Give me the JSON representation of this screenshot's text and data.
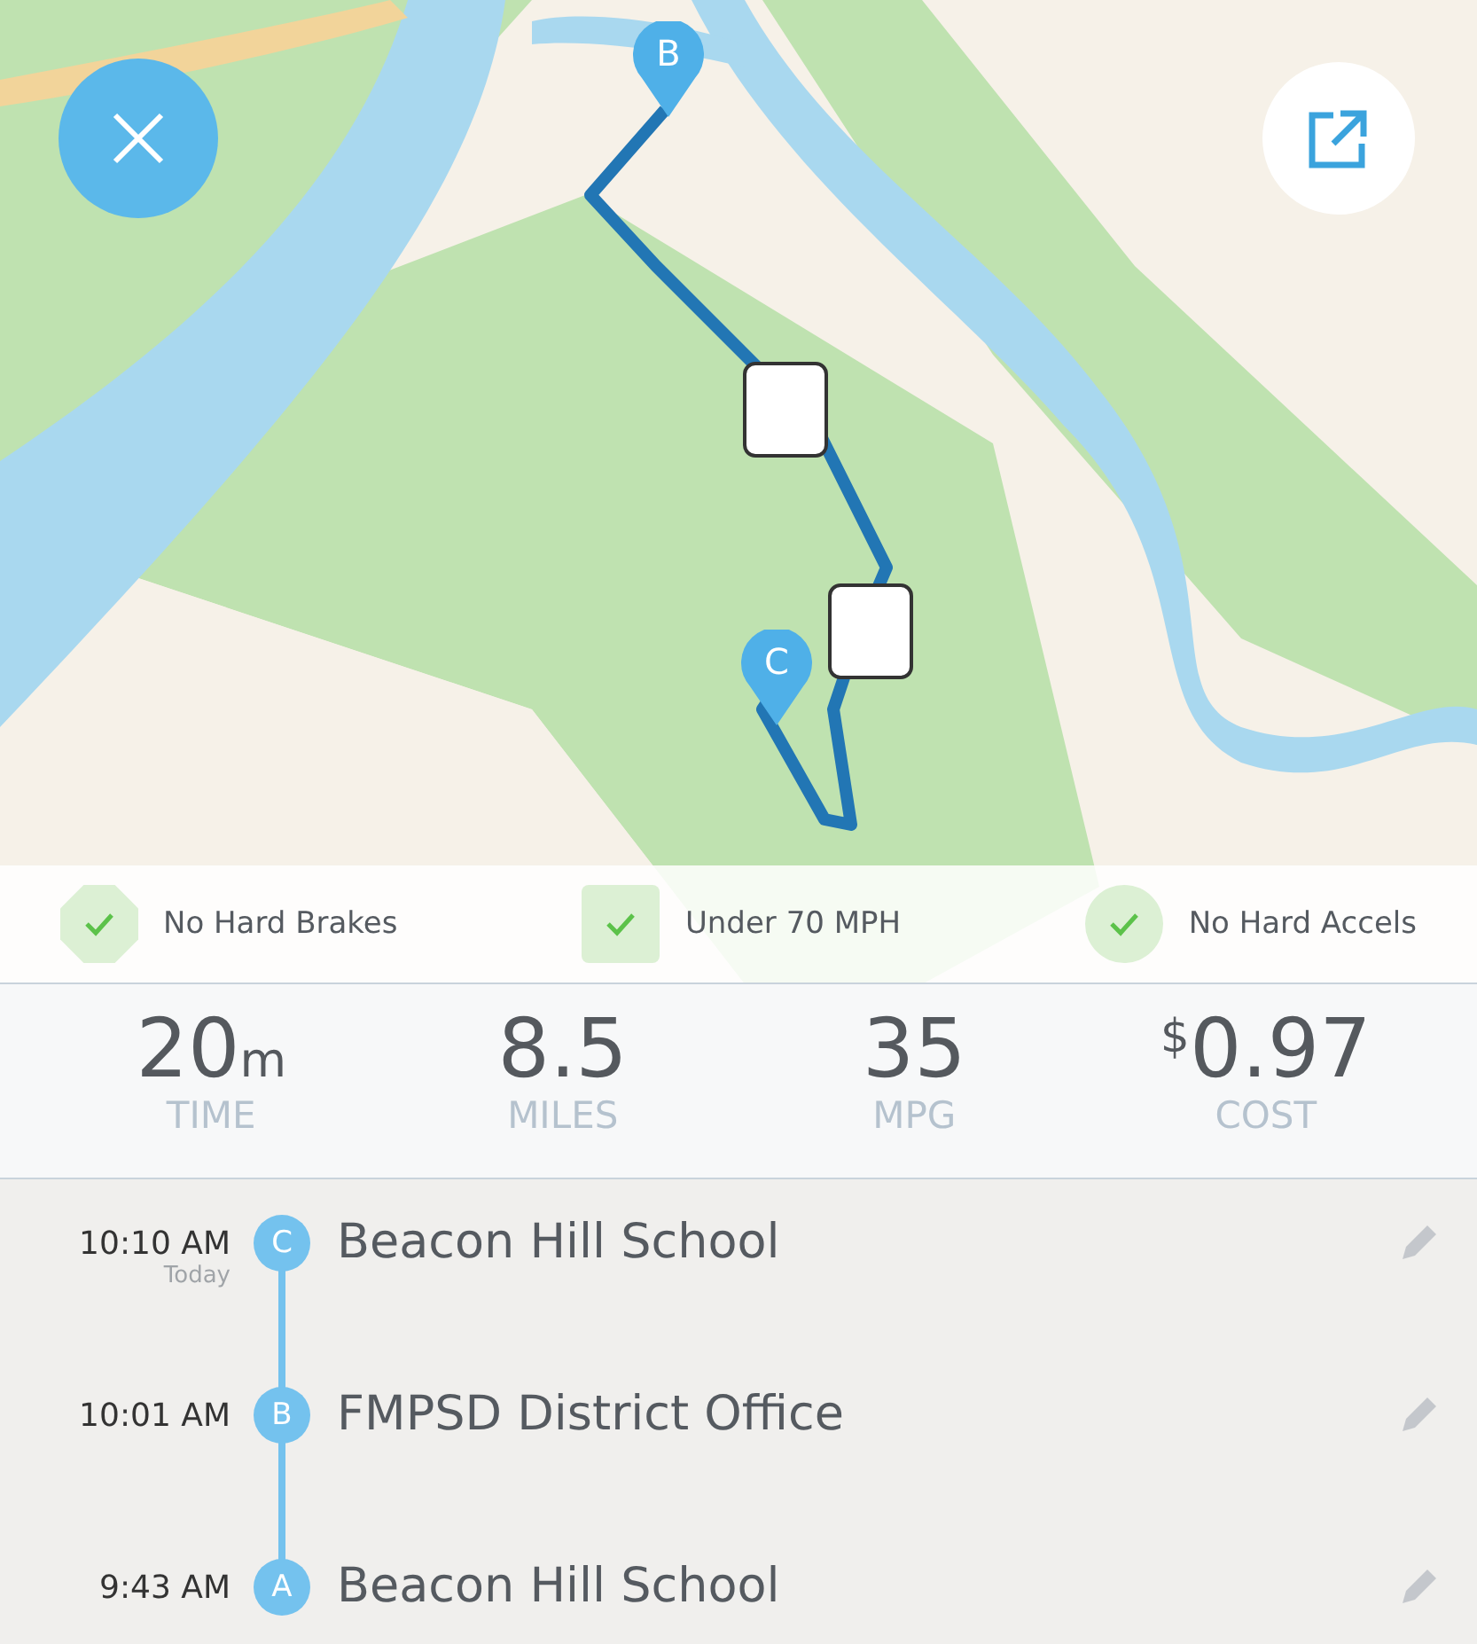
{
  "map": {
    "pins": [
      {
        "letter": "B"
      },
      {
        "letter": "C"
      }
    ]
  },
  "badges": [
    {
      "kind": "octagon",
      "label": "No Hard Brakes"
    },
    {
      "kind": "square",
      "label": "Under 70 MPH"
    },
    {
      "kind": "circle",
      "label": "No Hard Accels"
    }
  ],
  "stats": [
    {
      "value": "20",
      "unit": "m",
      "label": "TIME"
    },
    {
      "value": "8.5",
      "label": "MILES"
    },
    {
      "value": "35",
      "label": "MPG"
    },
    {
      "prefix": "$",
      "value": "0.97",
      "label": "COST"
    }
  ],
  "stops": [
    {
      "time": "10:10 AM",
      "note": "Today",
      "letter": "C",
      "place": "Beacon Hill School"
    },
    {
      "time": "10:01 AM",
      "letter": "B",
      "place": "FMPSD District Office"
    },
    {
      "time": "9:43 AM",
      "letter": "A",
      "place": "Beacon Hill School"
    }
  ]
}
